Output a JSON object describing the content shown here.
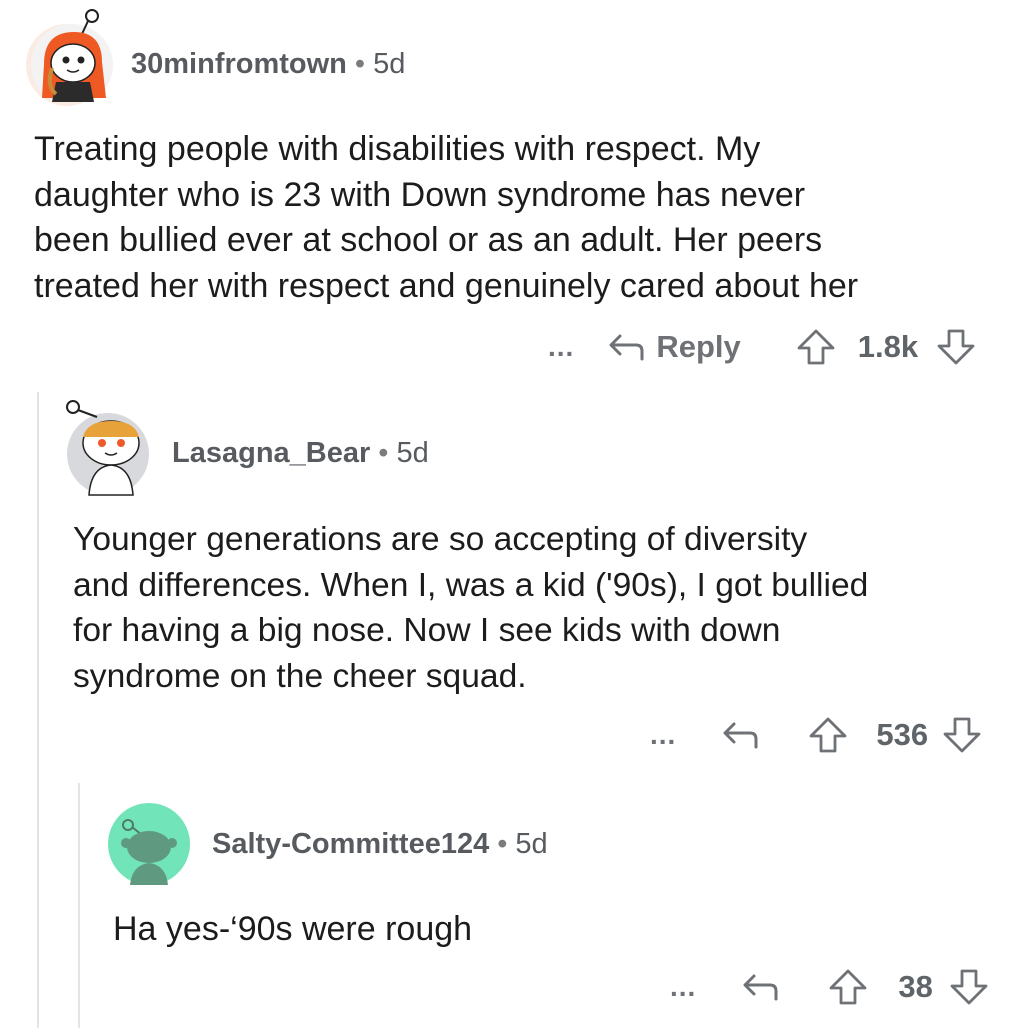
{
  "comments": [
    {
      "username": "30minfromtown",
      "separator": "•",
      "age": "5d",
      "lines": [
        "Treating people with disabilities with respect. My",
        "daughter who is 23 with Down syndrome has never",
        "been bullied ever at school or as an adult. Her peers",
        "treated her with respect and genuinely cared about her"
      ],
      "more_label": "...",
      "reply_label": "Reply",
      "score": "1.8k"
    },
    {
      "username": "Lasagna_Bear",
      "separator": "•",
      "age": "5d",
      "lines": [
        "Younger generations are so accepting of diversity",
        "and differences. When I, was a kid ('90s), I got bullied",
        "for having a big nose. Now I see kids with down",
        "syndrome on the cheer squad."
      ],
      "more_label": "...",
      "score": "536"
    },
    {
      "username": "Salty-Committee124",
      "separator": "•",
      "age": "5d",
      "lines": [
        "Ha yes-‘90s were rough"
      ],
      "more_label": "...",
      "score": "38"
    }
  ],
  "icons": {
    "reply": "reply-arrow-icon",
    "upvote": "upvote-arrow-icon",
    "downvote": "downvote-arrow-icon"
  },
  "colors": {
    "meta_text": "#575b60",
    "action_icon": "#6e7276",
    "thread_line": "#e4e4e4",
    "avatar_1_bg": "#ff6a1f",
    "avatar_2_bg": "#d7d9dc",
    "avatar_3_bg": "#72e4b9"
  }
}
